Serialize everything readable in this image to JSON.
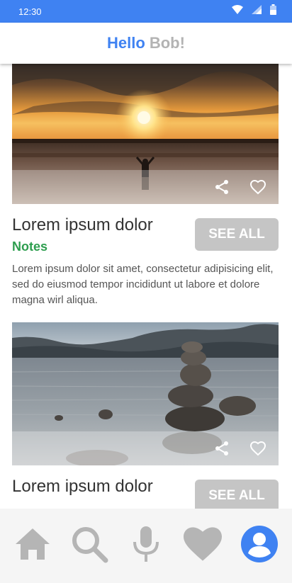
{
  "status_bar": {
    "time": "12:30"
  },
  "header": {
    "greeting": "Hello",
    "name": "Bob!"
  },
  "cards": [
    {
      "title": "Lorem ipsum dolor",
      "subtitle": "Notes",
      "description": "Lorem ipsum dolor sit amet, consectetur adipisicing elit, sed do eiusmod tempor incididunt ut labore et dolore magna wirl aliqua.",
      "button_label": "SEE ALL",
      "image": "sunset-beach-photo"
    },
    {
      "title": "Lorem ipsum dolor",
      "button_label": "SEE ALL",
      "image": "stacked-stones-lake-photo"
    }
  ],
  "bottom_nav": [
    {
      "icon": "home-icon"
    },
    {
      "icon": "search-icon"
    },
    {
      "icon": "microphone-icon"
    },
    {
      "icon": "heart-icon"
    },
    {
      "icon": "account-icon",
      "active": true
    }
  ],
  "colors": {
    "accent": "#3f82f2",
    "notes_green": "#2e9e4f",
    "button_gray": "#c5c5c5",
    "nav_gray": "#b5b5b5"
  }
}
